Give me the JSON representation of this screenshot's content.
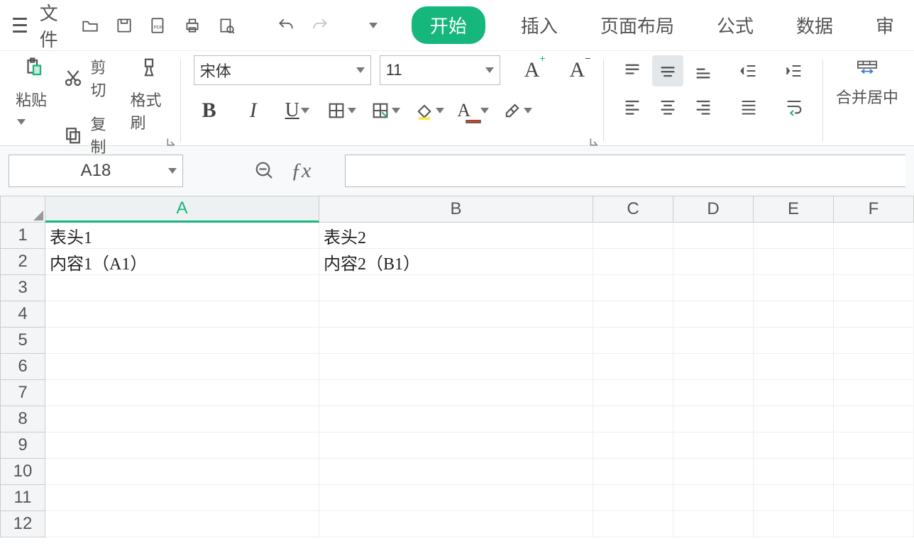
{
  "menu": {
    "file": "文件",
    "tabs": [
      "开始",
      "插入",
      "页面布局",
      "公式",
      "数据",
      "审"
    ],
    "active_tab_index": 0
  },
  "ribbon": {
    "paste": "粘贴",
    "cut": "剪切",
    "copy": "复制",
    "format_painter": "格式刷",
    "font_name": "宋体",
    "font_size": "11",
    "merge_center": "合并居中"
  },
  "namebox": "A18",
  "formula": "",
  "columns": [
    "A",
    "B",
    "C",
    "D",
    "E",
    "F"
  ],
  "row_count": 12,
  "cells": {
    "A1": "表头1",
    "B1": "表头2",
    "A2": "内容1（A1）",
    "B2": "内容2（B1）"
  }
}
